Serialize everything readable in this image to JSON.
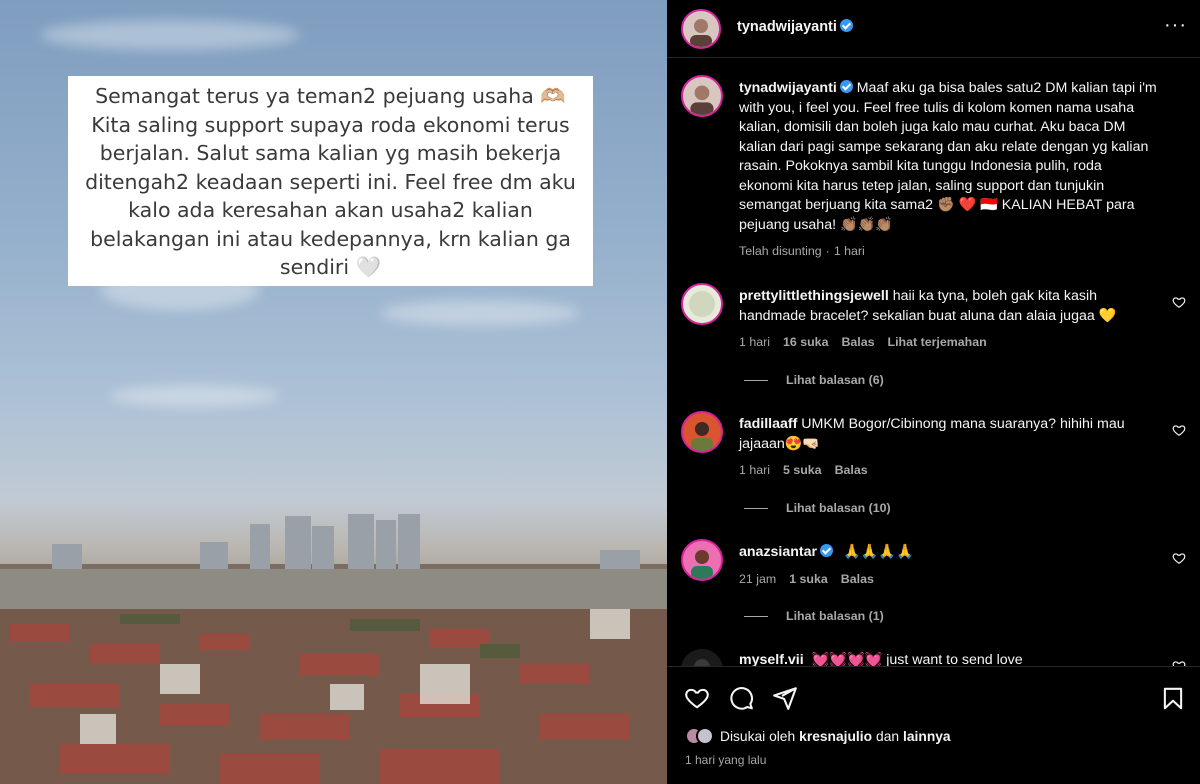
{
  "photo": {
    "caption": "Semangat terus ya teman2 pejuang usaha 🫶🏼 Kita saling support supaya roda ekonomi terus berjalan. Salut sama kalian yg masih bekerja ditengah2 keadaan seperti ini. Feel free dm aku kalo ada keresahan akan usaha2 kalian belakangan ini atau kedepannya, krn kalian ga sendiri 🤍"
  },
  "header": {
    "username": "tynadwijayanti",
    "more_icon": "more-horizontal-icon",
    "more_label": "···"
  },
  "post_caption": {
    "username": "tynadwijayanti",
    "text": "Maaf aku ga bisa bales satu2 DM kalian tapi i'm with you, i feel you. Feel free tulis di kolom komen nama usaha kalian, domisili dan boleh juga kalo mau curhat. Aku baca DM kalian dari pagi sampe sekarang dan aku relate dengan yg kalian rasain. Pokoknya sambil kita tunggu Indonesia pulih, roda ekonomi kita harus tetep jalan, saling support dan tunjukin semangat berjuang kita sama2 ✊🏽 ❤️ 🇮🇩 KALIAN HEBAT para pejuang usaha! 👏🏽👏🏽👏🏽",
    "edited": "Telah disunting",
    "time": "1 hari"
  },
  "comments": [
    {
      "username": "prettylittlethingsjewell",
      "text": "haii ka tyna, boleh gak kita kasih handmade bracelet? sekalian buat aluna dan alaia jugaa 💛",
      "time": "1 hari",
      "likes": "16 suka",
      "reply": "Balas",
      "translate": "Lihat terjemahan",
      "view_replies": "Lihat balasan (6)",
      "verified": false
    },
    {
      "username": "fadillaaff",
      "text": "UMKM Bogor/Cibinong mana suaranya? hihihi mau jajaaan😍🤜🏻",
      "time": "1 hari",
      "likes": "5 suka",
      "reply": "Balas",
      "view_replies": "Lihat balasan (10)",
      "verified": false
    },
    {
      "username": "anazsiantar",
      "text": "🙏🙏🙏🙏",
      "time": "21 jam",
      "likes": "1 suka",
      "reply": "Balas",
      "view_replies": "Lihat balasan (1)",
      "verified": true
    },
    {
      "username": "myself.vii",
      "text": "💓💓💓💓 just want to send love",
      "verified": false
    }
  ],
  "actions": {
    "like_icon": "heart-icon",
    "comment_icon": "comment-icon",
    "share_icon": "send-icon",
    "save_icon": "bookmark-icon"
  },
  "likes_line": {
    "prefix": "Disukai oleh",
    "user": "kresnajulio",
    "joiner": "dan",
    "others": "lainnya"
  },
  "posted": "1 hari yang lalu",
  "colors": {
    "background": "#000000",
    "text": "#f5f5f5",
    "muted": "#a8a8a8",
    "verified": "#3897f0",
    "story_ring": "#d6249f"
  }
}
